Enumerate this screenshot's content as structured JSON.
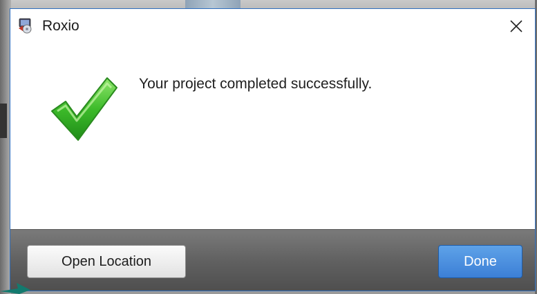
{
  "dialog": {
    "title": "Roxio",
    "message": "Your project completed successfully.",
    "icons": {
      "app": "roxio-app-icon",
      "close": "close-icon",
      "success": "green-checkmark-icon"
    }
  },
  "buttons": {
    "open_location_label": "Open Location",
    "done_label": "Done"
  },
  "colors": {
    "accent_blue": "#3c7fd6",
    "checkmark_green": "#2ea820",
    "annotation_arrow": "#137a6e"
  }
}
